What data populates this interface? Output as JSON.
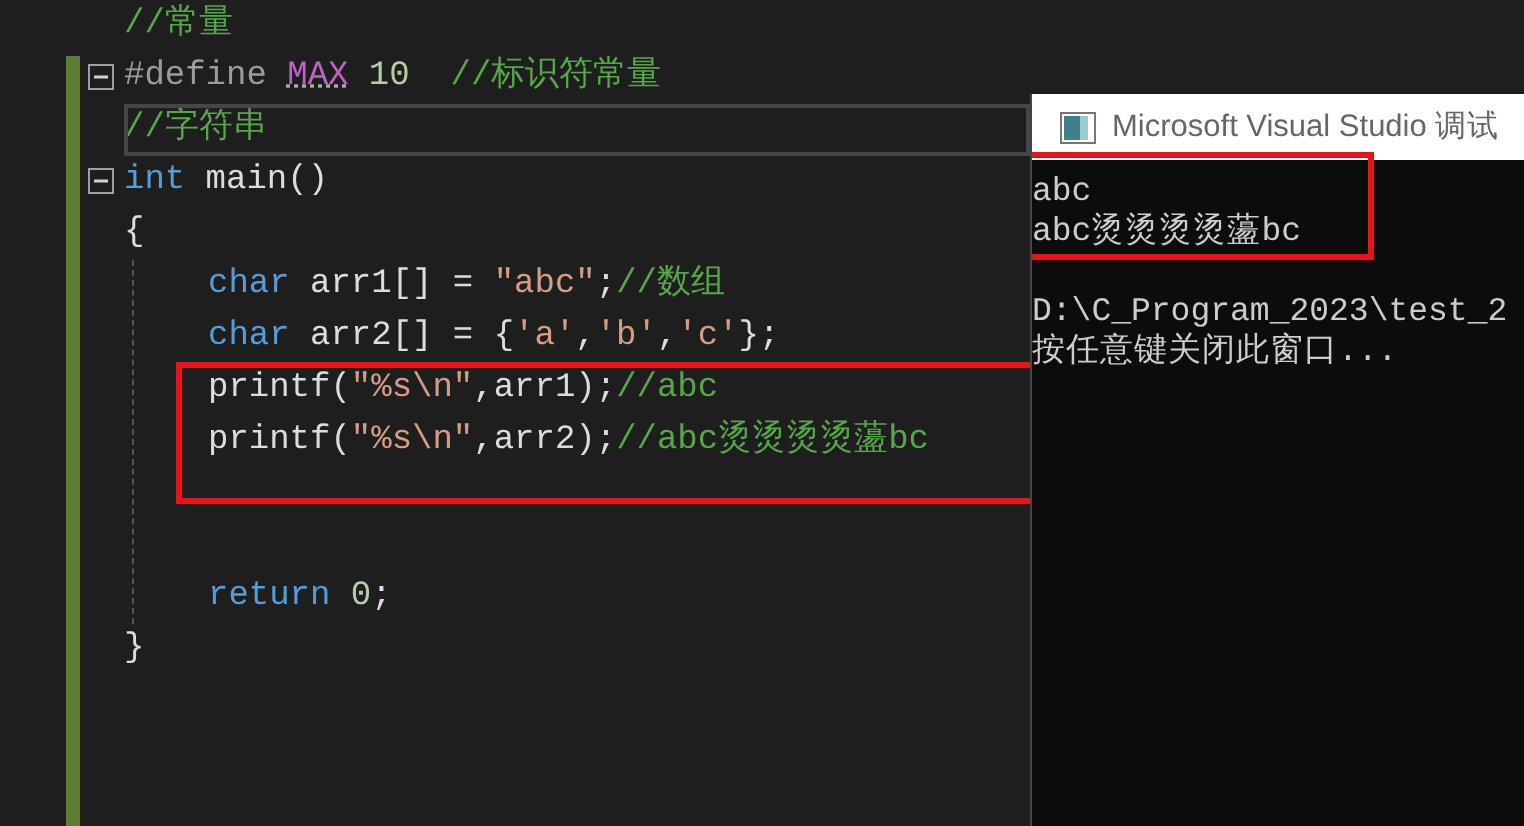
{
  "editor": {
    "lines": [
      {
        "kind": "code",
        "tokens": [
          {
            "kind": "comment",
            "text": "//常量"
          }
        ]
      },
      {
        "kind": "code",
        "expanded": true,
        "tokens": [
          {
            "kind": "preproc",
            "text": "#define "
          },
          {
            "kind": "macro",
            "text": "MAX"
          },
          {
            "kind": "number",
            "text": " 10"
          },
          {
            "kind": "comment",
            "text": "  //标识符常量"
          }
        ]
      },
      {
        "kind": "code",
        "current": true,
        "tokens": [
          {
            "kind": "comment",
            "text": "//字符串"
          }
        ]
      },
      {
        "kind": "code",
        "expanded": true,
        "tokens": [
          {
            "kind": "keyword",
            "text": "int"
          },
          {
            "kind": "text",
            "text": " main()"
          }
        ]
      },
      {
        "kind": "code",
        "tokens": [
          {
            "kind": "text",
            "text": "{"
          }
        ],
        "children": [
          {
            "kind": "code",
            "tokens": [
              {
                "kind": "keyword",
                "text": "char"
              },
              {
                "kind": "text",
                "text": " arr1[] = "
              },
              {
                "kind": "string",
                "text": "\"abc\""
              },
              {
                "kind": "text",
                "text": ";"
              },
              {
                "kind": "comment",
                "text": "//数组"
              }
            ]
          },
          {
            "kind": "code",
            "tokens": [
              {
                "kind": "keyword",
                "text": "char"
              },
              {
                "kind": "text",
                "text": " arr2[] = {"
              },
              {
                "kind": "string",
                "text": "'a'"
              },
              {
                "kind": "text",
                "text": ","
              },
              {
                "kind": "string",
                "text": "'b'"
              },
              {
                "kind": "text",
                "text": ","
              },
              {
                "kind": "string",
                "text": "'c'"
              },
              {
                "kind": "text",
                "text": "};"
              }
            ]
          },
          {
            "kind": "code",
            "highlighted": true,
            "tokens": [
              {
                "kind": "text",
                "text": "printf("
              },
              {
                "kind": "string",
                "text": "\"%s\\n\""
              },
              {
                "kind": "text",
                "text": ",arr1);"
              },
              {
                "kind": "comment",
                "text": "//abc"
              }
            ]
          },
          {
            "kind": "code",
            "highlighted": true,
            "tokens": [
              {
                "kind": "text",
                "text": "printf("
              },
              {
                "kind": "string",
                "text": "\"%s\\n\""
              },
              {
                "kind": "text",
                "text": ",arr2);"
              },
              {
                "kind": "comment",
                "text": "//abc烫烫烫烫蘯bc"
              }
            ]
          },
          {
            "kind": "blank"
          },
          {
            "kind": "blank"
          },
          {
            "kind": "code",
            "tokens": [
              {
                "kind": "keyword",
                "text": "return"
              },
              {
                "kind": "number",
                "text": " 0"
              },
              {
                "kind": "text",
                "text": ";"
              }
            ]
          }
        ]
      },
      {
        "kind": "code",
        "tokens": [
          {
            "kind": "text",
            "text": "}"
          }
        ]
      }
    ]
  },
  "console": {
    "title": "Microsoft Visual Studio 调试",
    "lines": [
      {
        "kind": "text",
        "text": "abc",
        "highlighted": true
      },
      {
        "kind": "text",
        "text": "abc烫烫烫烫蘯bc",
        "highlighted": true
      },
      {
        "kind": "blank"
      },
      {
        "kind": "text",
        "text": "D:\\C_Program_2023\\test_2"
      },
      {
        "kind": "text",
        "text": "按任意键关闭此窗口..."
      }
    ]
  }
}
